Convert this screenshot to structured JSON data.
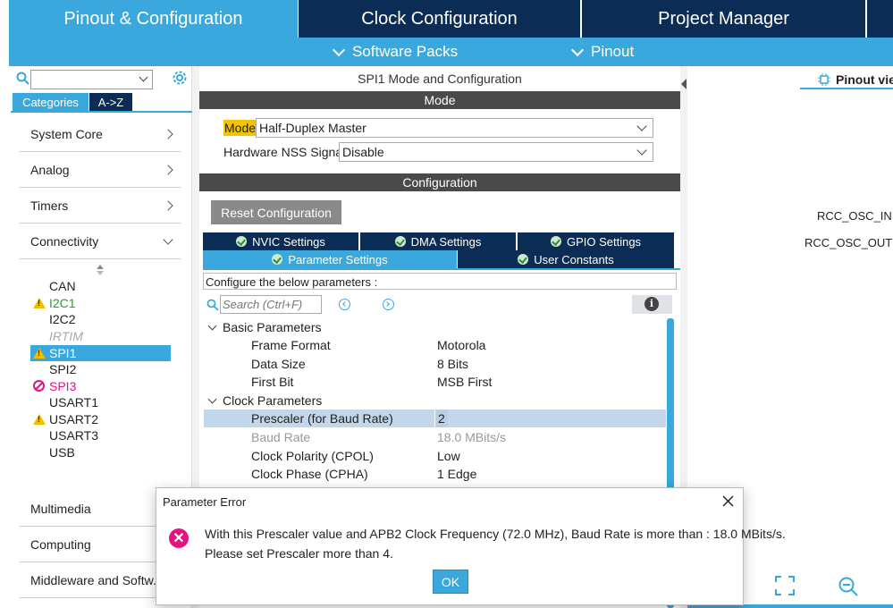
{
  "top_tabs": [
    {
      "label": "Pinout & Configuration"
    },
    {
      "label": "Clock Configuration"
    },
    {
      "label": "Project Manager"
    }
  ],
  "subbar": {
    "software_packs": "Software Packs",
    "pinout": "Pinout"
  },
  "left": {
    "categories_tab": "Categories",
    "az_tab": "A->Z",
    "nav": {
      "system_core": "System Core",
      "analog": "Analog",
      "timers": "Timers",
      "connectivity": "Connectivity",
      "multimedia": "Multimedia",
      "computing": "Computing",
      "middleware": "Middleware and Softw..."
    },
    "peripherals": [
      "CAN",
      "I2C1",
      "I2C2",
      "IRTIM",
      "SPI1",
      "SPI2",
      "SPI3",
      "USART1",
      "USART2",
      "USART3",
      "USB"
    ],
    "colors": {
      "warning": "#f0c000",
      "error": "#e0157f",
      "ok_green": "#2a8f3a",
      "accent": "#3aa8dc",
      "dark_navy": "#0b2c55"
    }
  },
  "center": {
    "title": "SPI1 Mode and Configuration",
    "mode_bar": "Mode",
    "mode_label": "Mode",
    "mode_value": "Half-Duplex Master",
    "nss_label": "Hardware NSS Signal",
    "nss_value": "Disable",
    "config_bar": "Configuration",
    "reset_button": "Reset Configuration",
    "tabs": {
      "nvic": "NVIC Settings",
      "dma": "DMA Settings",
      "gpio": "GPIO Settings",
      "parameter": "Parameter Settings",
      "user_constants": "User Constants"
    },
    "configure_hint": "Configure the below parameters :",
    "search_placeholder": "Search (Ctrl+F)",
    "basic_group": "Basic Parameters",
    "clock_group": "Clock Parameters",
    "params": {
      "frame_format": {
        "name": "Frame Format",
        "value": "Motorola"
      },
      "data_size": {
        "name": "Data Size",
        "value": "8 Bits"
      },
      "first_bit": {
        "name": "First Bit",
        "value": "MSB First"
      },
      "prescaler": {
        "name": "Prescaler (for Baud Rate)",
        "value": "2"
      },
      "baud_rate": {
        "name": "Baud Rate",
        "value": "18.0 MBits/s"
      },
      "cpol": {
        "name": "Clock Polarity (CPOL)",
        "value": "Low"
      },
      "cpha": {
        "name": "Clock Phase (CPHA)",
        "value": "1 Edge"
      }
    }
  },
  "right": {
    "pinout_view": "Pinout view",
    "rcc_in": "RCC_OSC_IN",
    "rcc_out": "RCC_OSC_OUT"
  },
  "dialog": {
    "title": "Parameter Error",
    "line1": "With this Prescaler value and APB2 Clock Frequency (72.0 MHz), Baud Rate is more than : 18.0 MBits/s.",
    "line2": "Please set Prescaler more than 4.",
    "ok_button": "OK"
  }
}
